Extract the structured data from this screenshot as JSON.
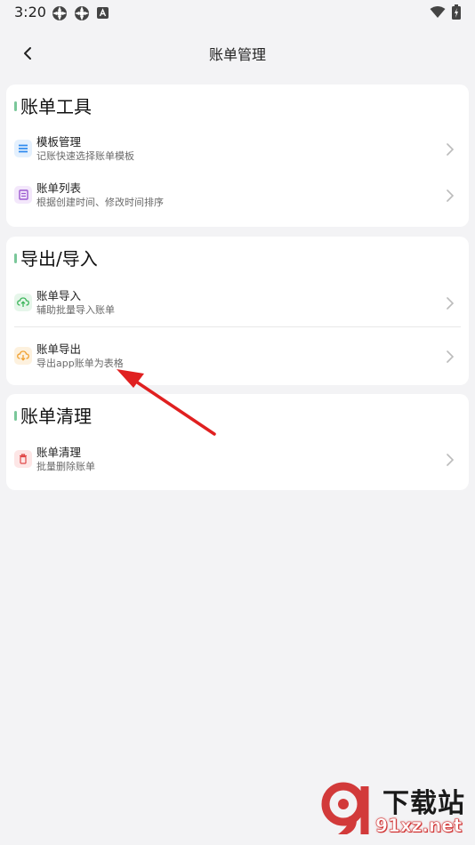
{
  "status_bar": {
    "time": "3:20"
  },
  "header": {
    "title": "账单管理"
  },
  "sections": [
    {
      "title": "账单工具",
      "items": [
        {
          "title": "模板管理",
          "subtitle": "记账快速选择账单模板",
          "icon": "list-icon",
          "color": "#2f8bef"
        },
        {
          "title": "账单列表",
          "subtitle": "根据创建时间、修改时间排序",
          "icon": "document-icon",
          "color": "#9b59d0"
        }
      ]
    },
    {
      "title": "导出/导入",
      "items": [
        {
          "title": "账单导入",
          "subtitle": "辅助批量导入账单",
          "icon": "cloud-upload-icon",
          "color": "#3bb55a"
        },
        {
          "title": "账单导出",
          "subtitle": "导出app账单为表格",
          "icon": "cloud-download-icon",
          "color": "#f0a030"
        }
      ]
    },
    {
      "title": "账单清理",
      "items": [
        {
          "title": "账单清理",
          "subtitle": "批量删除账单",
          "icon": "trash-icon",
          "color": "#e04848"
        }
      ]
    }
  ],
  "watermark": {
    "brand": "下载站",
    "url": "91xz.net"
  },
  "colors": {
    "accent_marker": "#7ac79a",
    "annotation_arrow": "#e02020"
  }
}
